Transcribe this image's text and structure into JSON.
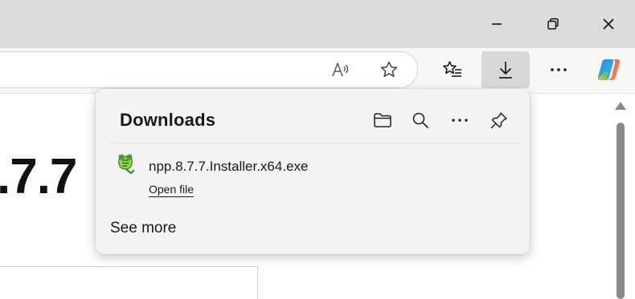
{
  "window": {
    "controls": [
      {
        "name": "minimize-button",
        "icon": "minimize-icon"
      },
      {
        "name": "restore-button",
        "icon": "restore-icon"
      },
      {
        "name": "close-button",
        "icon": "close-icon"
      }
    ]
  },
  "toolbar": {
    "address_icons": [
      "read-aloud-icon",
      "favorite-star-icon"
    ],
    "buttons": [
      "favorites-icon",
      "downloads-icon",
      "more-icon",
      "copilot-icon"
    ]
  },
  "page": {
    "version_text": ".7.7"
  },
  "downloads": {
    "title": "Downloads",
    "header_icons": [
      "folder-icon",
      "search-icon",
      "more-options-icon",
      "pin-icon"
    ],
    "items": [
      {
        "file_name": "npp.8.7.7.Installer.x64.exe",
        "action_label": "Open file",
        "icon": "notepad-plus-plus-icon"
      }
    ],
    "see_more_label": "See more"
  },
  "colors": {
    "titlebar": "#dcdcdc",
    "toolbar": "#f7f7f7",
    "flyout": "#f3f3f3",
    "active_button": "#d8d8d8"
  }
}
